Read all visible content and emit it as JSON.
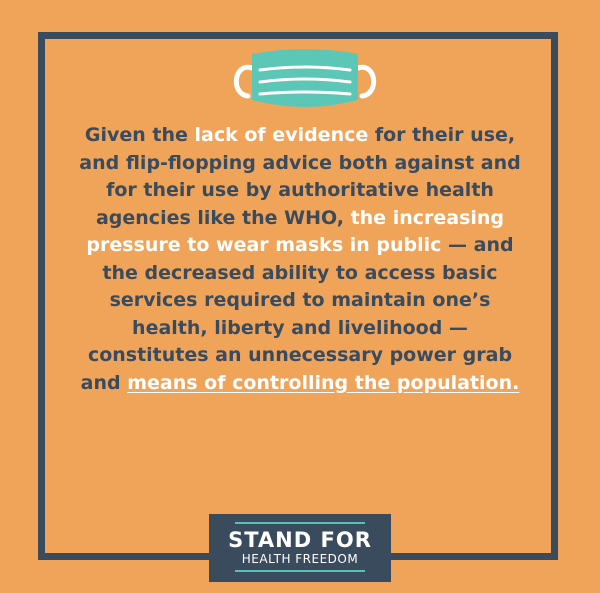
{
  "quote": {
    "p1": "Given the ",
    "h1": "lack of evidence",
    "p2": " for their use, and flip-flopping advice both against and for their use by authoritative health agencies like the WHO, ",
    "h2": "the increasing pressure to wear masks in public",
    "p3": " — and the decreased ability to access basic services required to maintain one’s health, liberty and livelihood — constitutes an unnecessary power grab and ",
    "link": "means of controlling the population."
  },
  "logo": {
    "title": "STAND FOR",
    "subtitle": "HEALTH FREEDOM"
  },
  "colors": {
    "background": "#f0a45a",
    "frame": "#3a4b5e",
    "highlight": "#ffffff",
    "mask": "#5cc7b7"
  },
  "icons": {
    "mask": "face-mask-icon"
  }
}
